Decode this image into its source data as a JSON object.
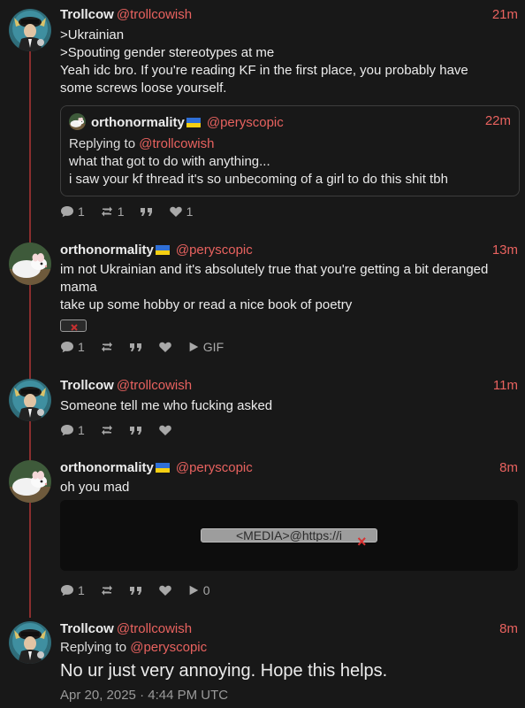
{
  "posts": [
    {
      "name": "Trollcow",
      "handle": "@trollcowish",
      "time": "21m",
      "lines": [
        ">Ukrainian",
        ">Spouting gender stereotypes at me",
        "Yeah idc bro. If you're reading KF in the first place, you probably have",
        "some screws loose yourself."
      ],
      "quote": {
        "name": "orthonormality",
        "handle": "@peryscopic",
        "time": "22m",
        "replying_prefix": "Replying to",
        "replying_handle": "@trollcowish",
        "lines": [
          "what that got to do with anything...",
          "i saw your kf thread it's so unbecoming of a girl to do this shit tbh"
        ]
      },
      "counts": {
        "replies": "1",
        "reposts": "1",
        "likes": "1"
      }
    },
    {
      "name": "orthonormality",
      "handle": "@peryscopic",
      "time": "13m",
      "lines": [
        "im not Ukrainian and it's absolutely true that you're getting a bit deranged",
        "mama",
        "take up some hobby or read a nice book of poetry"
      ],
      "counts": {
        "replies": "1"
      },
      "extra_label": "GIF"
    },
    {
      "name": "Trollcow",
      "handle": "@trollcowish",
      "time": "11m",
      "lines": [
        "Someone tell me who fucking asked"
      ],
      "counts": {
        "replies": "1"
      }
    },
    {
      "name": "orthonormality",
      "handle": "@peryscopic",
      "time": "8m",
      "lines": [
        "oh you mad"
      ],
      "media_alt": "<MEDIA>@https://i",
      "counts": {
        "replies": "1",
        "plays": "0"
      }
    },
    {
      "name": "Trollcow",
      "handle": "@trollcowish",
      "time": "8m",
      "replying_prefix": "Replying to",
      "replying_handle": "@peryscopic",
      "text": "No ur just very annoying. Hope this helps.",
      "timestamp": "Apr 20, 2025 · 4:44 PM UTC"
    }
  ],
  "icons": {
    "reply": "speech-bubble-icon",
    "repost": "repost-icon",
    "quote": "quote-icon",
    "like": "heart-icon",
    "play": "play-icon",
    "flag": "ukraine-flag-icon"
  },
  "colors": {
    "background": "#181818",
    "accent": "#e8625f",
    "thread_line": "#8a2e2e",
    "text": "#ececec",
    "muted": "#a8a8a8",
    "flag_blue": "#2f6fd6",
    "flag_yellow": "#f5cf12"
  }
}
